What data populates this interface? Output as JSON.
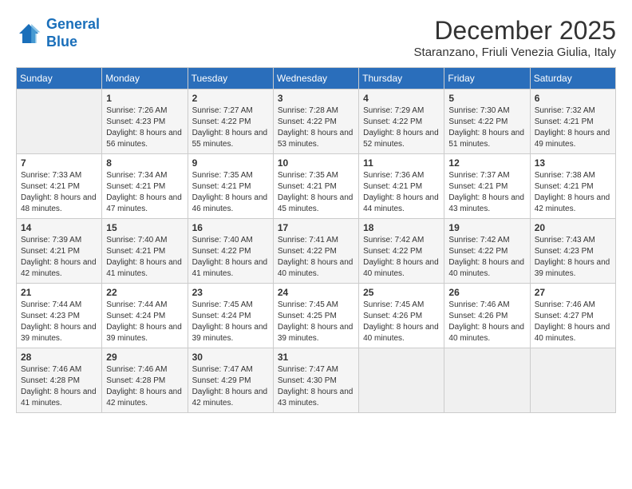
{
  "logo": {
    "line1": "General",
    "line2": "Blue"
  },
  "header": {
    "month": "December 2025",
    "location": "Staranzano, Friuli Venezia Giulia, Italy"
  },
  "weekdays": [
    "Sunday",
    "Monday",
    "Tuesday",
    "Wednesday",
    "Thursday",
    "Friday",
    "Saturday"
  ],
  "weeks": [
    [
      {
        "day": "",
        "sunrise": "",
        "sunset": "",
        "daylight": ""
      },
      {
        "day": "1",
        "sunrise": "Sunrise: 7:26 AM",
        "sunset": "Sunset: 4:23 PM",
        "daylight": "Daylight: 8 hours and 56 minutes."
      },
      {
        "day": "2",
        "sunrise": "Sunrise: 7:27 AM",
        "sunset": "Sunset: 4:22 PM",
        "daylight": "Daylight: 8 hours and 55 minutes."
      },
      {
        "day": "3",
        "sunrise": "Sunrise: 7:28 AM",
        "sunset": "Sunset: 4:22 PM",
        "daylight": "Daylight: 8 hours and 53 minutes."
      },
      {
        "day": "4",
        "sunrise": "Sunrise: 7:29 AM",
        "sunset": "Sunset: 4:22 PM",
        "daylight": "Daylight: 8 hours and 52 minutes."
      },
      {
        "day": "5",
        "sunrise": "Sunrise: 7:30 AM",
        "sunset": "Sunset: 4:22 PM",
        "daylight": "Daylight: 8 hours and 51 minutes."
      },
      {
        "day": "6",
        "sunrise": "Sunrise: 7:32 AM",
        "sunset": "Sunset: 4:21 PM",
        "daylight": "Daylight: 8 hours and 49 minutes."
      }
    ],
    [
      {
        "day": "7",
        "sunrise": "Sunrise: 7:33 AM",
        "sunset": "Sunset: 4:21 PM",
        "daylight": "Daylight: 8 hours and 48 minutes."
      },
      {
        "day": "8",
        "sunrise": "Sunrise: 7:34 AM",
        "sunset": "Sunset: 4:21 PM",
        "daylight": "Daylight: 8 hours and 47 minutes."
      },
      {
        "day": "9",
        "sunrise": "Sunrise: 7:35 AM",
        "sunset": "Sunset: 4:21 PM",
        "daylight": "Daylight: 8 hours and 46 minutes."
      },
      {
        "day": "10",
        "sunrise": "Sunrise: 7:35 AM",
        "sunset": "Sunset: 4:21 PM",
        "daylight": "Daylight: 8 hours and 45 minutes."
      },
      {
        "day": "11",
        "sunrise": "Sunrise: 7:36 AM",
        "sunset": "Sunset: 4:21 PM",
        "daylight": "Daylight: 8 hours and 44 minutes."
      },
      {
        "day": "12",
        "sunrise": "Sunrise: 7:37 AM",
        "sunset": "Sunset: 4:21 PM",
        "daylight": "Daylight: 8 hours and 43 minutes."
      },
      {
        "day": "13",
        "sunrise": "Sunrise: 7:38 AM",
        "sunset": "Sunset: 4:21 PM",
        "daylight": "Daylight: 8 hours and 42 minutes."
      }
    ],
    [
      {
        "day": "14",
        "sunrise": "Sunrise: 7:39 AM",
        "sunset": "Sunset: 4:21 PM",
        "daylight": "Daylight: 8 hours and 42 minutes."
      },
      {
        "day": "15",
        "sunrise": "Sunrise: 7:40 AM",
        "sunset": "Sunset: 4:21 PM",
        "daylight": "Daylight: 8 hours and 41 minutes."
      },
      {
        "day": "16",
        "sunrise": "Sunrise: 7:40 AM",
        "sunset": "Sunset: 4:22 PM",
        "daylight": "Daylight: 8 hours and 41 minutes."
      },
      {
        "day": "17",
        "sunrise": "Sunrise: 7:41 AM",
        "sunset": "Sunset: 4:22 PM",
        "daylight": "Daylight: 8 hours and 40 minutes."
      },
      {
        "day": "18",
        "sunrise": "Sunrise: 7:42 AM",
        "sunset": "Sunset: 4:22 PM",
        "daylight": "Daylight: 8 hours and 40 minutes."
      },
      {
        "day": "19",
        "sunrise": "Sunrise: 7:42 AM",
        "sunset": "Sunset: 4:22 PM",
        "daylight": "Daylight: 8 hours and 40 minutes."
      },
      {
        "day": "20",
        "sunrise": "Sunrise: 7:43 AM",
        "sunset": "Sunset: 4:23 PM",
        "daylight": "Daylight: 8 hours and 39 minutes."
      }
    ],
    [
      {
        "day": "21",
        "sunrise": "Sunrise: 7:44 AM",
        "sunset": "Sunset: 4:23 PM",
        "daylight": "Daylight: 8 hours and 39 minutes."
      },
      {
        "day": "22",
        "sunrise": "Sunrise: 7:44 AM",
        "sunset": "Sunset: 4:24 PM",
        "daylight": "Daylight: 8 hours and 39 minutes."
      },
      {
        "day": "23",
        "sunrise": "Sunrise: 7:45 AM",
        "sunset": "Sunset: 4:24 PM",
        "daylight": "Daylight: 8 hours and 39 minutes."
      },
      {
        "day": "24",
        "sunrise": "Sunrise: 7:45 AM",
        "sunset": "Sunset: 4:25 PM",
        "daylight": "Daylight: 8 hours and 39 minutes."
      },
      {
        "day": "25",
        "sunrise": "Sunrise: 7:45 AM",
        "sunset": "Sunset: 4:26 PM",
        "daylight": "Daylight: 8 hours and 40 minutes."
      },
      {
        "day": "26",
        "sunrise": "Sunrise: 7:46 AM",
        "sunset": "Sunset: 4:26 PM",
        "daylight": "Daylight: 8 hours and 40 minutes."
      },
      {
        "day": "27",
        "sunrise": "Sunrise: 7:46 AM",
        "sunset": "Sunset: 4:27 PM",
        "daylight": "Daylight: 8 hours and 40 minutes."
      }
    ],
    [
      {
        "day": "28",
        "sunrise": "Sunrise: 7:46 AM",
        "sunset": "Sunset: 4:28 PM",
        "daylight": "Daylight: 8 hours and 41 minutes."
      },
      {
        "day": "29",
        "sunrise": "Sunrise: 7:46 AM",
        "sunset": "Sunset: 4:28 PM",
        "daylight": "Daylight: 8 hours and 42 minutes."
      },
      {
        "day": "30",
        "sunrise": "Sunrise: 7:47 AM",
        "sunset": "Sunset: 4:29 PM",
        "daylight": "Daylight: 8 hours and 42 minutes."
      },
      {
        "day": "31",
        "sunrise": "Sunrise: 7:47 AM",
        "sunset": "Sunset: 4:30 PM",
        "daylight": "Daylight: 8 hours and 43 minutes."
      },
      {
        "day": "",
        "sunrise": "",
        "sunset": "",
        "daylight": ""
      },
      {
        "day": "",
        "sunrise": "",
        "sunset": "",
        "daylight": ""
      },
      {
        "day": "",
        "sunrise": "",
        "sunset": "",
        "daylight": ""
      }
    ]
  ]
}
